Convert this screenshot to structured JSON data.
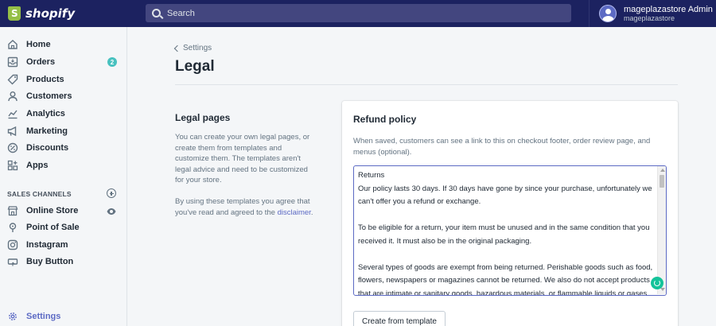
{
  "topbar": {
    "brand": "shopify",
    "search_placeholder": "Search",
    "account_name": "mageplazastore Admin",
    "account_store": "mageplazastore"
  },
  "sidebar": {
    "items": [
      {
        "label": "Home",
        "icon": "home-icon"
      },
      {
        "label": "Orders",
        "icon": "orders-icon",
        "badge": "2"
      },
      {
        "label": "Products",
        "icon": "tag-icon"
      },
      {
        "label": "Customers",
        "icon": "person-icon"
      },
      {
        "label": "Analytics",
        "icon": "chart-icon"
      },
      {
        "label": "Marketing",
        "icon": "megaphone-icon"
      },
      {
        "label": "Discounts",
        "icon": "discount-icon"
      },
      {
        "label": "Apps",
        "icon": "apps-icon"
      }
    ],
    "sales_channels_label": "SALES CHANNELS",
    "channels": [
      {
        "label": "Online Store",
        "icon": "store-icon"
      },
      {
        "label": "Point of Sale",
        "icon": "pos-icon"
      },
      {
        "label": "Instagram",
        "icon": "instagram-icon"
      },
      {
        "label": "Buy Button",
        "icon": "buy-button-icon"
      }
    ],
    "settings_label": "Settings"
  },
  "main": {
    "back_label": "Settings",
    "title": "Legal",
    "section_title": "Legal pages",
    "section_desc": "You can create your own legal pages, or create them from templates and customize them. The templates aren't legal advice and need to be customized for your store.",
    "section_desc2_prefix": "By using these templates you agree that you've read and agreed to the ",
    "disclaimer_link": "disclaimer",
    "disclaimer_suffix": "."
  },
  "refund_card": {
    "title": "Refund policy",
    "help": "When saved, customers can see a link to this on checkout footer, order review page, and menus (optional).",
    "content": "Returns\nOur policy lasts 30 days. If 30 days have gone by since your purchase, unfortunately we can't offer you a refund or exchange.\n\nTo be eligible for a return, your item must be unused and in the same condition that you received it. It must also be in the original packaging.\n\nSeveral types of goods are exempt from being returned. Perishable goods such as food, flowers, newspapers or magazines cannot be returned. We also do not accept products that are intimate or sanitary goods, hazardous materials, or flammable liquids or gases.",
    "template_button": "Create from template"
  },
  "colors": {
    "topbar": "#1c2260",
    "accent": "#5c6ac4",
    "badge": "#47c1bf",
    "assistant": "#15c39a"
  }
}
